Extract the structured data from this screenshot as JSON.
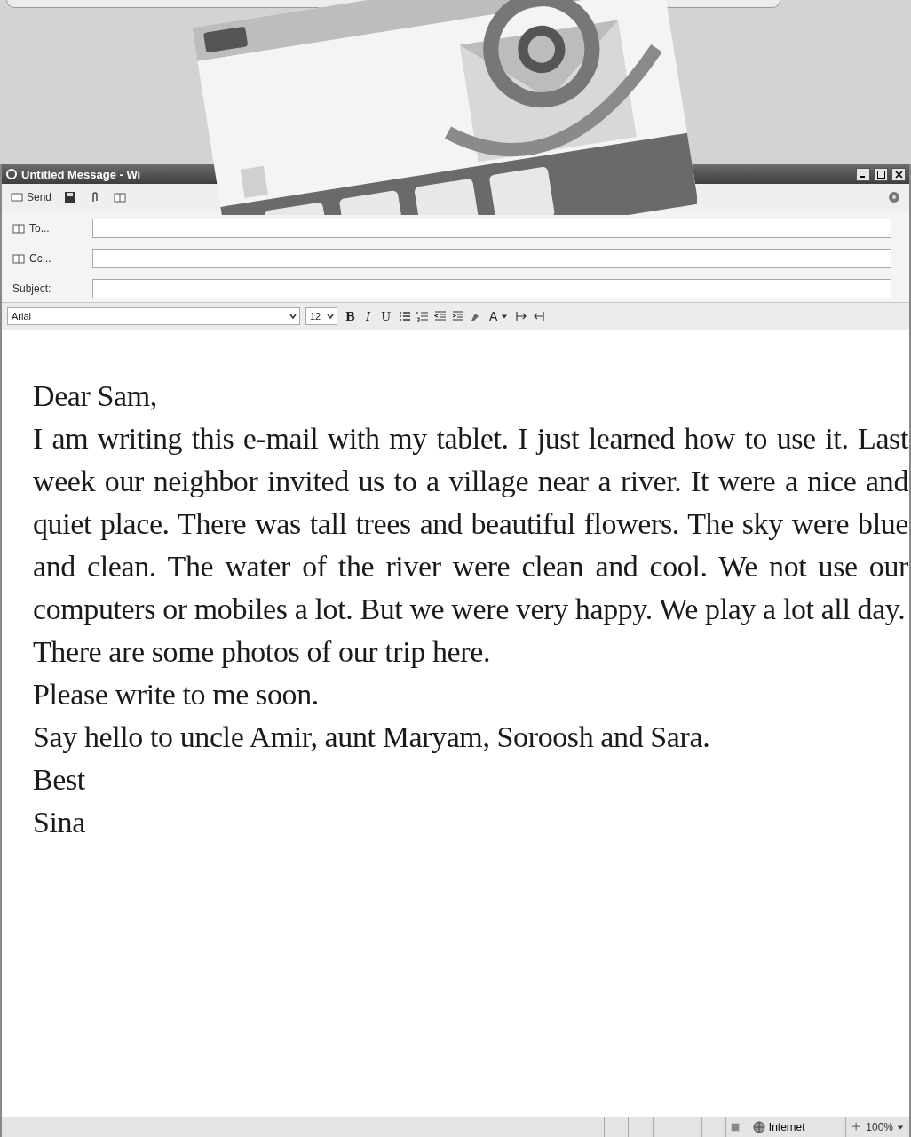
{
  "window": {
    "title": "Untitled Message - Wi"
  },
  "toolbar": {
    "send_label": "Send"
  },
  "fields": [
    {
      "kind": "recipient",
      "label": "To..."
    },
    {
      "kind": "recipient",
      "label": "Cc..."
    },
    {
      "kind": "subject",
      "label": "Subject:"
    }
  ],
  "format_bar": {
    "font": "Arial",
    "size": "12",
    "bold": "B",
    "italic": "I",
    "underline": "U",
    "font_color": "A"
  },
  "body": {
    "paragraphs": [
      "Dear Sam,",
      "I am writing this e-mail with my tablet. I just learned how to use it. Last week our neighbor invited us to a village near a river. It were a nice and quiet place. There was tall trees and beautiful flowers. The sky were blue and clean. The water of the river were clean and cool. We not use our computers or mobiles a lot. But we were very happy. We play a lot all day.",
      "There are some photos of our trip here.",
      "Please write to me soon.",
      "Say hello to uncle Amir, aunt Maryam, Soroosh and Sara.",
      "Best",
      "Sina"
    ]
  },
  "status_bar": {
    "zone": "Internet",
    "zoom": "100%"
  }
}
